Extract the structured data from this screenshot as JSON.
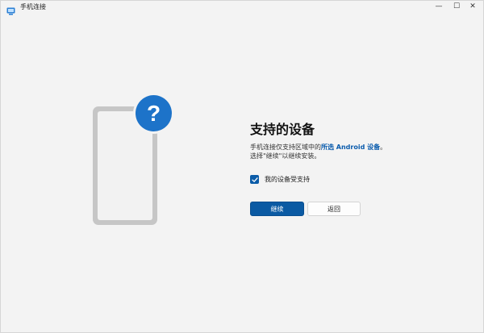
{
  "window": {
    "title": "手机连接",
    "minimize_symbol": "—",
    "maximize_symbol": "☐",
    "close_symbol": "✕"
  },
  "illustration": {
    "badge_symbol": "?",
    "badge_color": "#1d73c9",
    "phone_color": "#c6c6c6"
  },
  "content": {
    "heading": "支持的设备",
    "desc_prefix": "手机连接仅支持区域中的",
    "desc_link": "所选 Android 设备",
    "desc_suffix": "。",
    "desc_line2": "选择\"继续\"以继续安装。",
    "checkbox_label": "我的设备受支持",
    "checkbox_checked": true
  },
  "buttons": {
    "continue_label": "继续",
    "back_label": "返回"
  },
  "colors": {
    "accent": "#0b5aa3",
    "link": "#0b5cad",
    "background": "#f3f3f3"
  }
}
